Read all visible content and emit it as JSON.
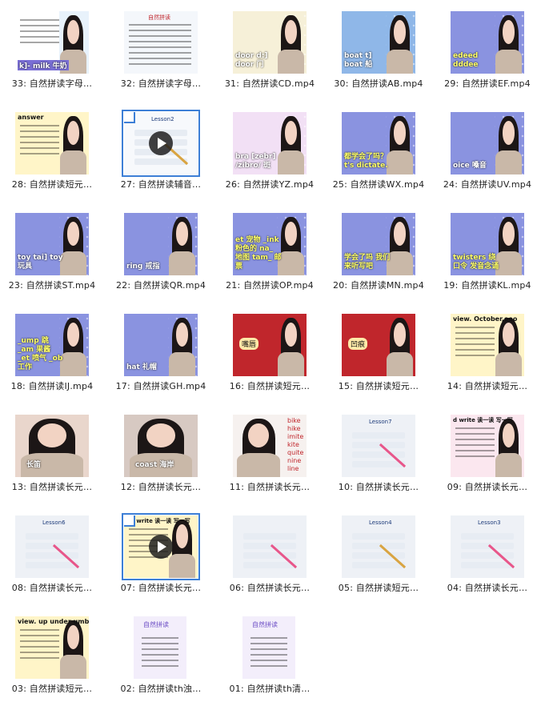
{
  "files": [
    {
      "label": "33: 自然拼读字母…",
      "style": "kids-chart",
      "bg": "#e8f2fb",
      "caption": "k]- milk 牛奶",
      "selected": false
    },
    {
      "label": "32: 自然拼读字母…",
      "style": "document",
      "bg": "#f4f7fb",
      "caption": "自然拼读",
      "selected": false
    },
    {
      "label": "31: 自然拼读CD.mp4",
      "style": "cartoon",
      "bg": "#f6f0d8",
      "caption": "door d:] door 门",
      "selected": false
    },
    {
      "label": "30: 自然拼读AB.mp4",
      "style": "cartoon",
      "bg": "#8fb7e8",
      "caption": "boat t] boat 船",
      "selected": false
    },
    {
      "label": "29: 自然拼读EF.mp4",
      "style": "letters",
      "bg": "#8a93e0",
      "caption": "edeed dddee",
      "selected": false
    },
    {
      "label": "28: 自然拼读短元…",
      "style": "answer",
      "bg": "#fff5c8",
      "caption": "answer",
      "selected": false
    },
    {
      "label": "27: 自然拼读辅音…",
      "style": "lesson-play",
      "bg": "#f7f9fc",
      "caption": "Lesson2",
      "selected": true
    },
    {
      "label": "26: 自然拼读YZ.mp4",
      "style": "cartoon",
      "bg": "#f2e0f5",
      "caption": "bra [zebr] /zibro/ 斑",
      "selected": false
    },
    {
      "label": "25: 自然拼读WX.mp4",
      "style": "letters",
      "bg": "#8a93e0",
      "caption": "都学会了吗？ t's dictate.",
      "selected": false
    },
    {
      "label": "24: 自然拼读UV.mp4",
      "style": "cartoon",
      "bg": "#8a93e0",
      "caption": "oice 嗓音",
      "selected": false
    },
    {
      "label": "23: 自然拼读ST.mp4",
      "style": "cartoon",
      "bg": "#8a93e0",
      "caption": "toy tai] toy 玩具",
      "selected": false
    },
    {
      "label": "22: 自然拼读QR.mp4",
      "style": "cartoon",
      "bg": "#8a93e0",
      "caption": "ring 戒指",
      "selected": false
    },
    {
      "label": "21: 自然拼读OP.mp4",
      "style": "letters",
      "bg": "#8a93e0",
      "caption": "et 宠物 _ink 粉色的 na_ 地图 tam_ 邮票",
      "selected": false
    },
    {
      "label": "20: 自然拼读MN.mp4",
      "style": "letters",
      "bg": "#8a93e0",
      "caption": "学会了吗 我们来听写吧",
      "selected": false
    },
    {
      "label": "19: 自然拼读KL.mp4",
      "style": "letters",
      "bg": "#8a93e0",
      "caption": "twisters 绕口令 发音念诵",
      "selected": false
    },
    {
      "label": "18: 自然拼读IJ.mp4",
      "style": "letters",
      "bg": "#8a93e0",
      "caption": "_ump 跳 _am 果酱 _et 喷气 _ob 工作",
      "selected": false
    },
    {
      "label": "17: 自然拼读GH.mp4",
      "style": "cartoon",
      "bg": "#8a93e0",
      "caption": "hat 礼帽",
      "selected": false
    },
    {
      "label": "16: 自然拼读短元…",
      "style": "red-bg",
      "bg": "#c0262c",
      "caption": "嘴唇",
      "selected": false
    },
    {
      "label": "15: 自然拼读短元…",
      "style": "red-bg",
      "bg": "#c0262c",
      "caption": "凹痕",
      "selected": false
    },
    {
      "label": "14: 自然拼读短元…",
      "style": "answer",
      "bg": "#fff5c8",
      "caption": "view. October,ooo",
      "selected": false
    },
    {
      "label": "13: 自然拼读长元…",
      "style": "closeup",
      "bg": "#e9d6cc",
      "caption": "长笛",
      "selected": false
    },
    {
      "label": "12: 自然拼读长元…",
      "style": "closeup",
      "bg": "#d7c9c2",
      "caption": "coast 海岸",
      "selected": false
    },
    {
      "label": "11: 自然拼读长元…",
      "style": "word-list",
      "bg": "#f6f1ef",
      "caption": "bike hike imite kite quite nine line",
      "selected": false
    },
    {
      "label": "10: 自然拼读长元…",
      "style": "lesson-pen",
      "bg": "#eef1f6",
      "caption": "Lesson7",
      "selected": false
    },
    {
      "label": "09: 自然拼读长元…",
      "style": "write",
      "bg": "#fbe7ef",
      "caption": "d write 读一读 写一写",
      "selected": false
    },
    {
      "label": "08: 自然拼读长元…",
      "style": "lesson-pen",
      "bg": "#eef1f6",
      "caption": "Lesson6",
      "selected": false
    },
    {
      "label": "07: 自然拼读长元…",
      "style": "write-play",
      "bg": "#fff5c8",
      "caption": "nd write 读一读 写一写",
      "selected": true
    },
    {
      "label": "06: 自然拼读长元…",
      "style": "lesson-pen",
      "bg": "#eef1f6",
      "caption": "",
      "selected": false
    },
    {
      "label": "05: 自然拼读短元…",
      "style": "lesson-pen",
      "bg": "#eef1f6",
      "caption": "Lesson4",
      "selected": false
    },
    {
      "label": "04: 自然拼读长元…",
      "style": "lesson-pen",
      "bg": "#eef1f6",
      "caption": "Lesson3",
      "selected": false
    },
    {
      "label": "03: 自然拼读短元…",
      "style": "answer",
      "bg": "#fff5c8",
      "caption": "view. up under umbrella",
      "selected": false
    },
    {
      "label": "02: 自然拼读th浊…",
      "style": "th-card",
      "bg": "#f3eefb",
      "caption": "自然拼读",
      "selected": false
    },
    {
      "label": "01: 自然拼读th清…",
      "style": "th-card",
      "bg": "#f3eefb",
      "caption": "自然拼读",
      "selected": false
    }
  ]
}
